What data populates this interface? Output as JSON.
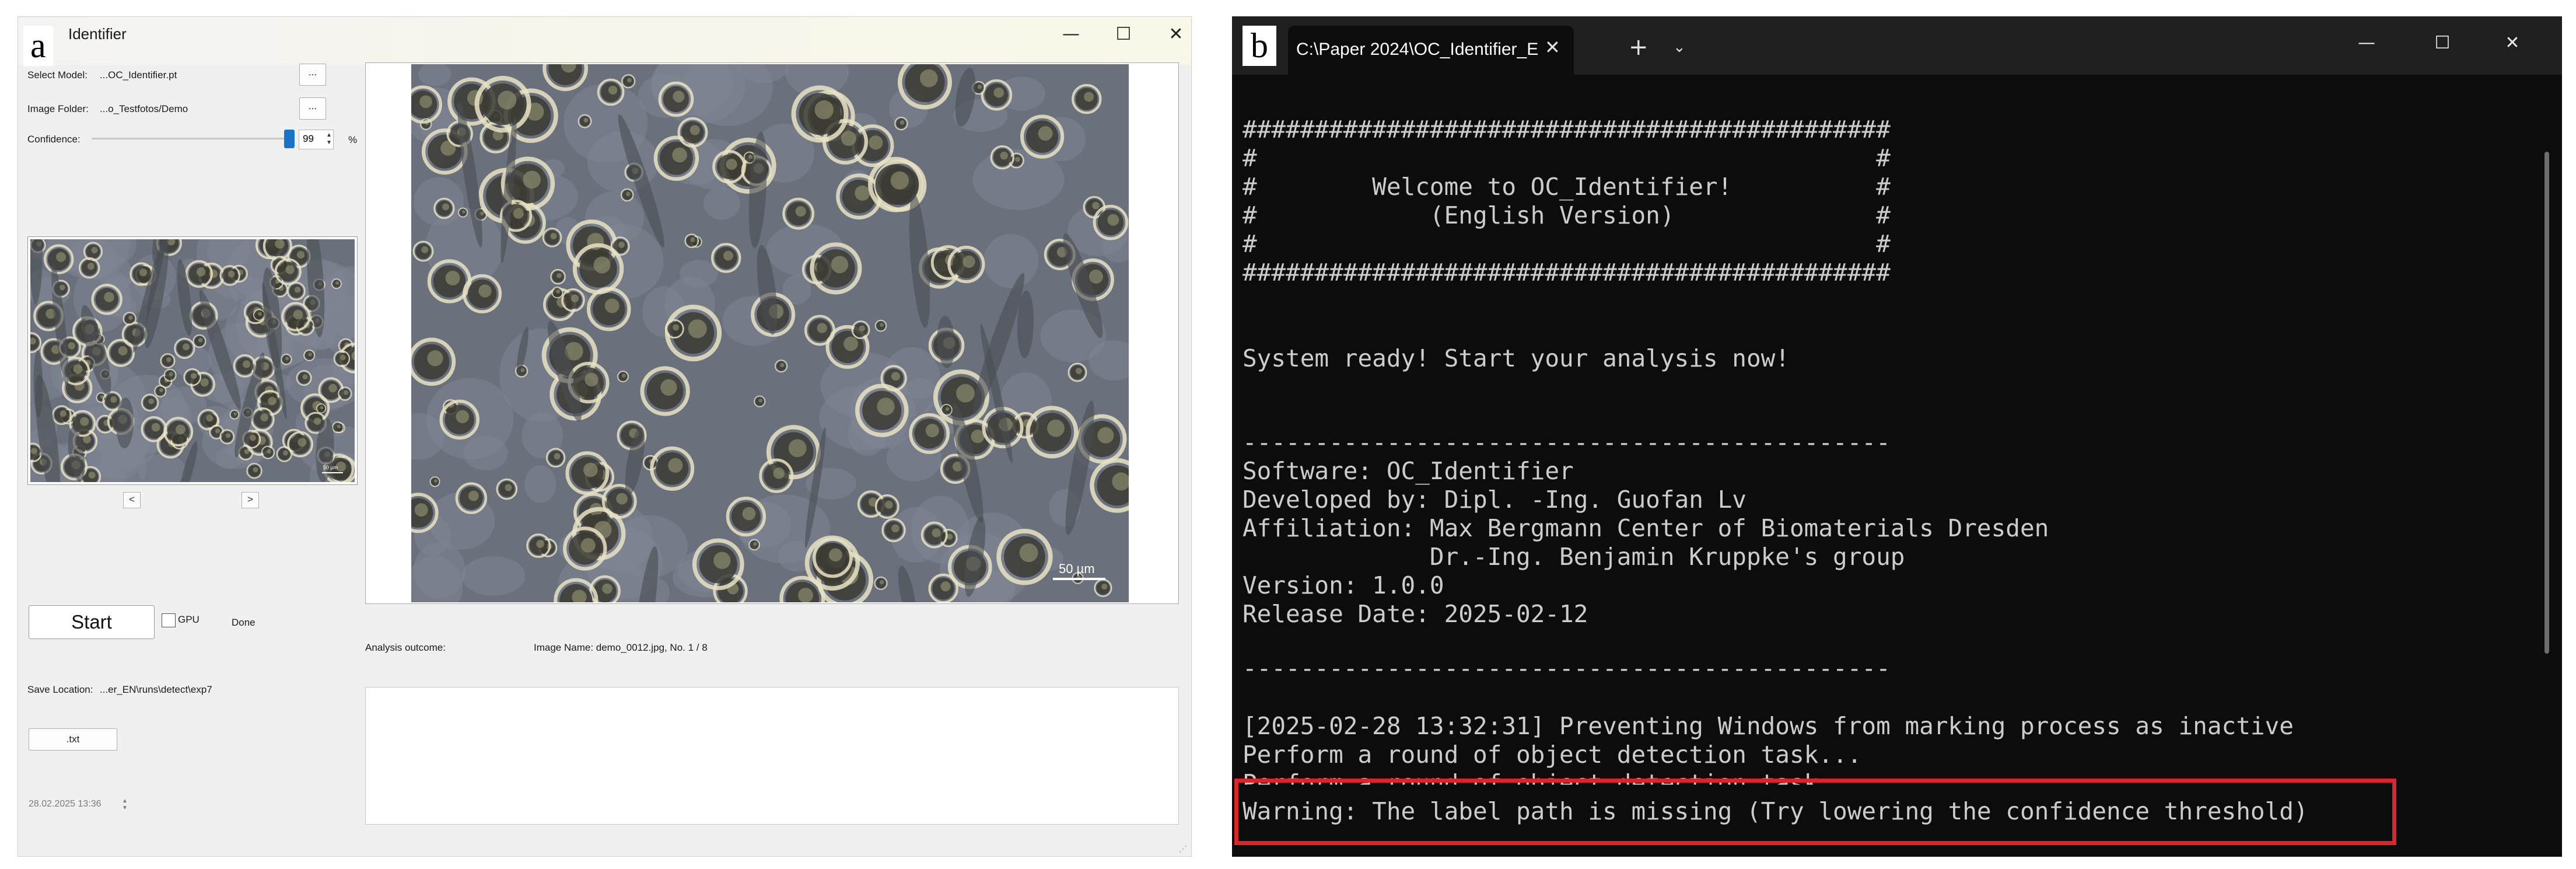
{
  "panel_a": {
    "letter": "a",
    "window_title": "Identifier",
    "window_controls": {
      "minimize": "—",
      "maximize": "☐",
      "close": "✕"
    },
    "select_model": {
      "label": "Select Model:",
      "value": "...OC_Identifier.pt",
      "button": "..."
    },
    "image_folder": {
      "label": "Image Folder:",
      "value": "...o_Testfotos/Demo",
      "button": "..."
    },
    "confidence": {
      "label": "Confidence:",
      "value": "99",
      "unit": "%",
      "level_percent": 99
    },
    "thumbnail": {
      "prev": "<",
      "next": ">",
      "scale_label": "50 µm"
    },
    "start_button": "Start",
    "gpu_label": "GPU",
    "status": "Done",
    "save_location": {
      "label": "Save Location:",
      "value": "...er_EN\\runs\\detect\\exp7"
    },
    "txt_button": ".txt",
    "datetime": "28.02.2025 13:36",
    "analysis_outcome_label": "Analysis outcome:",
    "image_name": "Image Name:  demo_0012.jpg,  No. 1 / 8",
    "main_image": {
      "scale_label": "50 µm"
    }
  },
  "panel_b": {
    "letter": "b",
    "tab_title": "C:\\Paper 2024\\OC_Identifier_E",
    "tab_close": "✕",
    "new_tab": "+",
    "dropdown": "⌄",
    "window_controls": {
      "minimize": "—",
      "maximize": "☐",
      "close": "✕"
    },
    "lines": [
      "#############################################",
      "#                                           #",
      "#        Welcome to OC_Identifier!          #",
      "#            (English Version)              #",
      "#                                           #",
      "#############################################",
      "System ready! Start your analysis now!",
      "---------------------------------------------",
      "Software: OC_Identifier",
      "Developed by: Dipl. -Ing. Guofan Lv",
      "Affiliation: Max Bergmann Center of Biomaterials Dresden",
      "             Dr.-Ing. Benjamin Kruppke's group",
      "Version: 1.0.0",
      "Release Date: 2025-02-12",
      "---------------------------------------------",
      "[2025-02-28 13:32:31] Preventing Windows from marking process as inactive",
      "Perform a round of object detection task...",
      "Perform a round of object detection task...",
      "Warning: The label path is missing (Try lowering the confidence threshold)"
    ],
    "highlight_color": "#d9262c"
  }
}
